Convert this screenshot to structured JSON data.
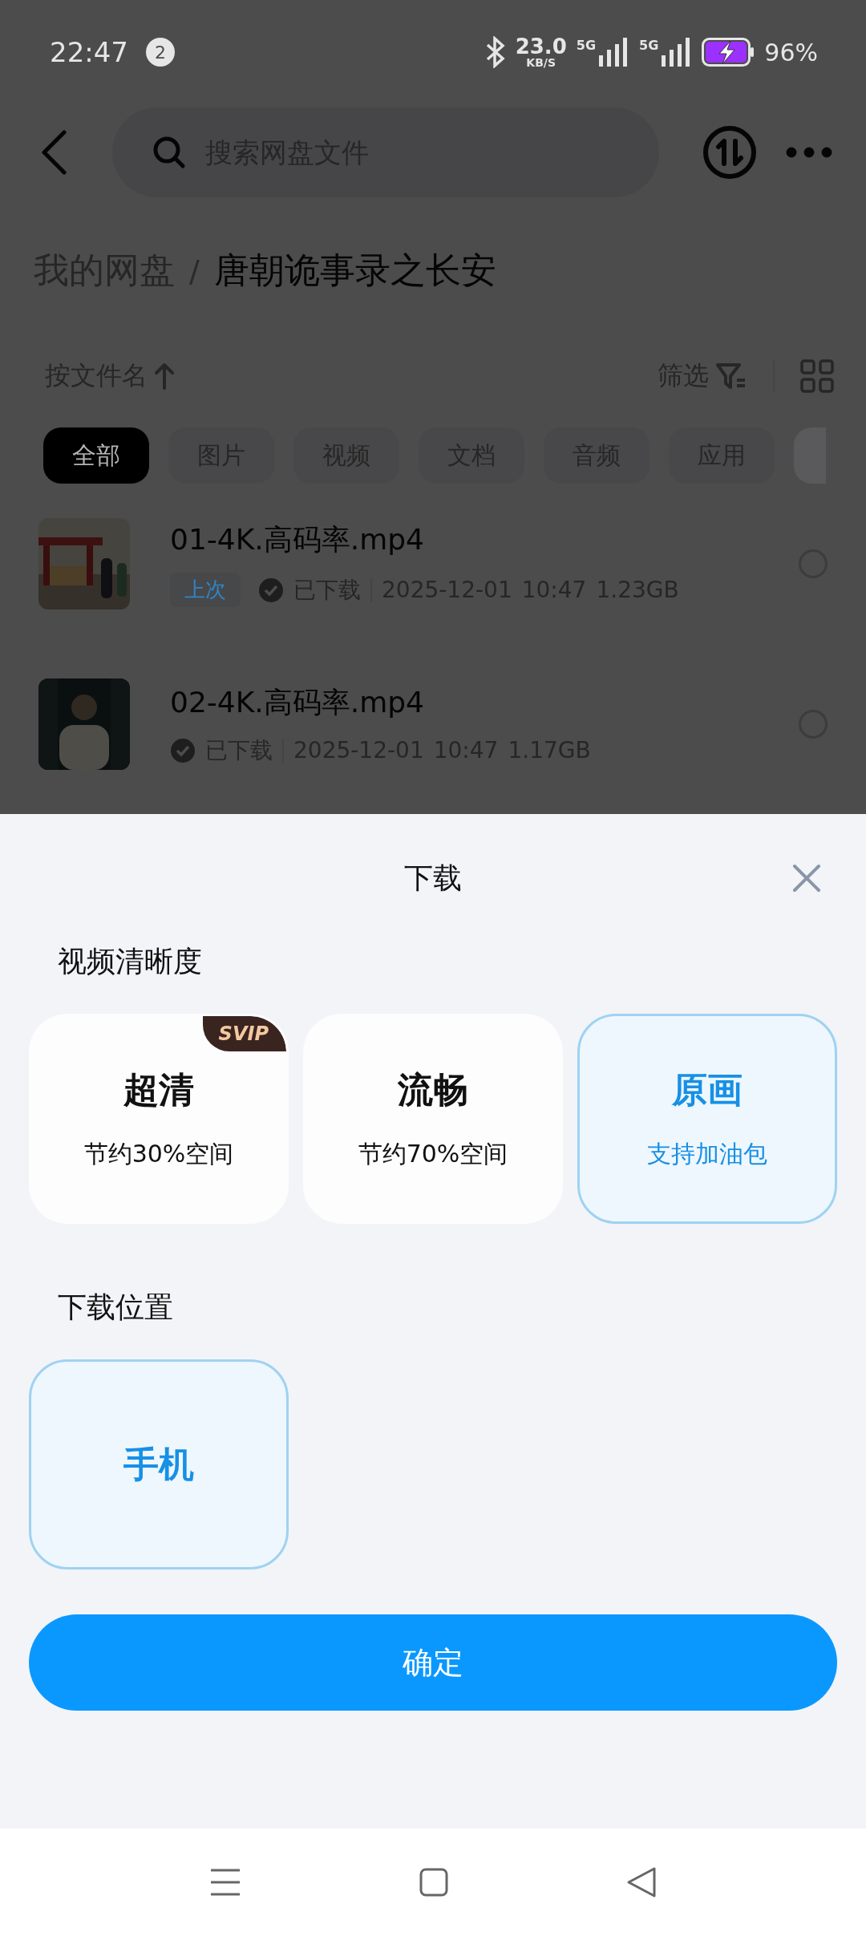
{
  "status_bar": {
    "time": "22:47",
    "notification_count": "2",
    "net_speed": "23.0",
    "net_speed_unit": "KB/S",
    "sim_labels": [
      "5G",
      "5G"
    ],
    "battery": "96%"
  },
  "header": {
    "search": {
      "placeholder": "搜索网盘文件"
    }
  },
  "breadcrumb": [
    "我的网盘",
    "唐朝诡事录之长安"
  ],
  "breadcrumb_separator": "/",
  "toolbar": {
    "sort": "按文件名",
    "filter": "筛选"
  },
  "chips": [
    {
      "label": "全部",
      "selected": true
    },
    {
      "label": "图片",
      "selected": false
    },
    {
      "label": "视频",
      "selected": false
    },
    {
      "label": "文档",
      "selected": false
    },
    {
      "label": "音频",
      "selected": false
    },
    {
      "label": "应用",
      "selected": false
    }
  ],
  "files": [
    {
      "name": "01-4K.高码率.mp4",
      "tag": "上次",
      "status": "已下载",
      "date": "2025-12-01",
      "time": "10:47",
      "size": "1.23GB",
      "selected": false
    },
    {
      "name": "02-4K.高码率.mp4",
      "status": "已下载",
      "date": "2025-12-01",
      "time": "10:47",
      "size": "1.17GB",
      "selected": false
    }
  ],
  "sheet": {
    "title": "下载",
    "quality_label": "视频清晰度",
    "quality_options": [
      {
        "title": "超清",
        "subtitle": "节约30%空间",
        "badge": "SVIP",
        "selected": false
      },
      {
        "title": "流畅",
        "subtitle": "节约70%空间",
        "selected": false
      },
      {
        "title": "原画",
        "subtitle": "支持加油包",
        "selected": true
      }
    ],
    "location_label": "下载位置",
    "location_options": [
      {
        "title": "手机",
        "selected": true
      }
    ],
    "confirm_button": "确定"
  }
}
